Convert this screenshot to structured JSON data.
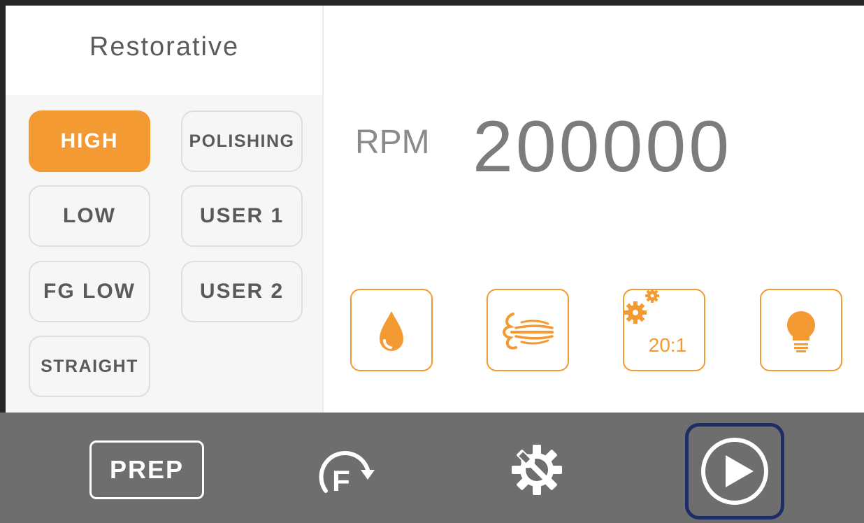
{
  "mode_panel": {
    "title": "Restorative",
    "buttons": [
      {
        "label": "HIGH",
        "active": true
      },
      {
        "label": "POLISHING",
        "active": false
      },
      {
        "label": "LOW",
        "active": false
      },
      {
        "label": "USER 1",
        "active": false
      },
      {
        "label": "FG LOW",
        "active": false
      },
      {
        "label": "USER 2",
        "active": false
      },
      {
        "label": "STRAIGHT",
        "active": false
      }
    ]
  },
  "speed": {
    "label": "RPM",
    "value": "200000"
  },
  "functions": {
    "water": {
      "icon": "water-drop-icon"
    },
    "air": {
      "icon": "air-spray-icon"
    },
    "gear_ratio": {
      "icon": "gears-icon",
      "label": "20:1"
    },
    "light": {
      "icon": "light-bulb-icon"
    }
  },
  "bottom_bar": {
    "prep_label": "PREP",
    "direction_label": "F",
    "settings_icon": "settings-wrench-icon",
    "play_icon": "play-icon"
  },
  "colors": {
    "accent": "#f39a32",
    "bar": "#6e6e6e",
    "focus": "#1f2d66"
  }
}
